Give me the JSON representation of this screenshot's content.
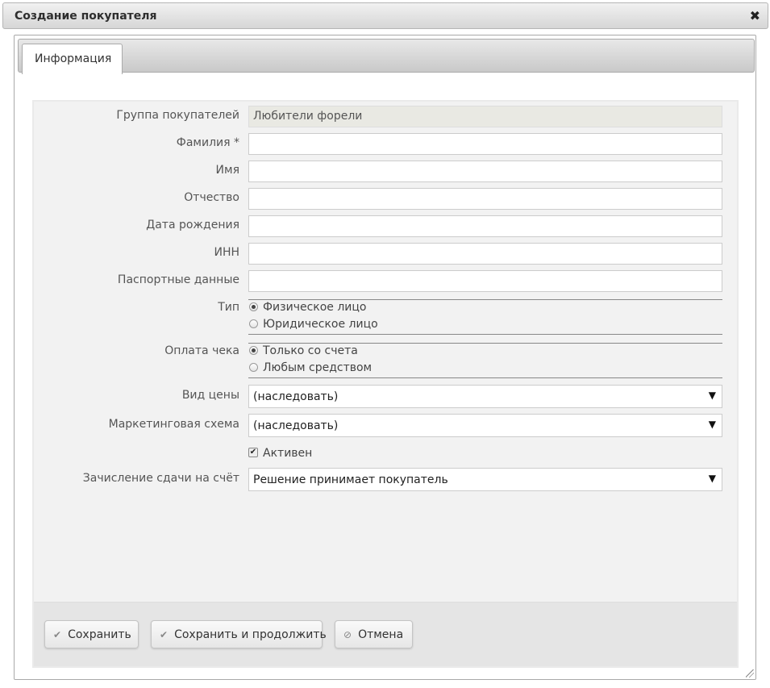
{
  "dialog": {
    "title": "Создание покупателя",
    "close_icon": "close-icon"
  },
  "tabs": [
    {
      "label": "Информация",
      "active": true
    }
  ],
  "form": {
    "customer_group": {
      "label": "Группа покупателей",
      "value": "Любители форели"
    },
    "last_name": {
      "label": "Фамилия *",
      "value": ""
    },
    "first_name": {
      "label": "Имя",
      "value": ""
    },
    "middle_name": {
      "label": "Отчество",
      "value": ""
    },
    "birth_date": {
      "label": "Дата рождения",
      "value": ""
    },
    "inn": {
      "label": "ИНН",
      "value": ""
    },
    "passport": {
      "label": "Паспортные данные",
      "value": ""
    },
    "type": {
      "label": "Тип",
      "options": [
        {
          "label": "Физическое лицо",
          "checked": true
        },
        {
          "label": "Юридическое лицо",
          "checked": false
        }
      ]
    },
    "payment": {
      "label": "Оплата чека",
      "options": [
        {
          "label": "Только со счета",
          "checked": true
        },
        {
          "label": "Любым средством",
          "checked": false
        }
      ]
    },
    "price_type": {
      "label": "Вид цены",
      "value": "(наследовать)"
    },
    "marketing_scheme": {
      "label": "Маркетинговая схема",
      "value": "(наследовать)"
    },
    "active": {
      "label": "Активен",
      "checked": true
    },
    "change_to_account": {
      "label": "Зачисление сдачи на счёт",
      "value": "Решение принимает покупатель"
    }
  },
  "buttons": {
    "save": "Сохранить",
    "save_continue": "Сохранить и продолжить",
    "cancel": "Отмена"
  }
}
